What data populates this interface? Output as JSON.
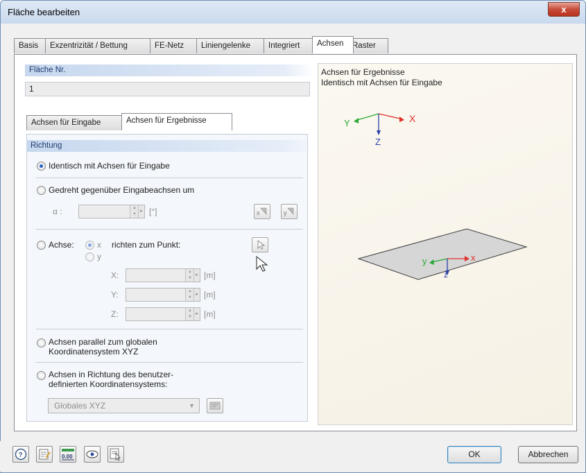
{
  "window": {
    "title": "Fläche bearbeiten",
    "close_label": "x"
  },
  "tabs": [
    "Basis",
    "Exzentrizität / Bettung",
    "FE-Netz",
    "Liniengelenke",
    "Integriert",
    "Achsen",
    "Raster"
  ],
  "active_tab": "Achsen",
  "flaeche": {
    "label": "Fläche Nr.",
    "value": "1"
  },
  "subtabs": [
    "Achsen für Eingabe",
    "Achsen für Ergebnisse"
  ],
  "active_subtab": "Achsen für Ergebnisse",
  "richtung": {
    "header": "Richtung",
    "opt_identisch": "Identisch mit Achsen für Eingabe",
    "opt_gedreht": "Gedreht gegenüber Eingabeachsen um",
    "alpha_label": "α :",
    "alpha_unit": "[°]",
    "opt_achse": "Achse:",
    "achse_x": "x",
    "achse_y": "y",
    "richten_label": "richten zum Punkt:",
    "x_label": "X:",
    "y_label": "Y:",
    "z_label": "Z:",
    "unit_m": "[m]",
    "opt_parallel_1": "Achsen parallel zum globalen",
    "opt_parallel_2": "Koordinatensystem XYZ",
    "opt_benutzer_1": "Achsen in Richtung des benutzer-",
    "opt_benutzer_2": "definierten Koordinatensystems:",
    "combo_value": "Globales XYZ"
  },
  "preview": {
    "line1": "Achsen für Ergebnisse",
    "line2": "Identisch mit Achsen für Eingabe",
    "axis_X": "X",
    "axis_Y": "Y",
    "axis_Z": "Z",
    "axis_x": "x",
    "axis_y": "y",
    "axis_z": "z"
  },
  "buttons": {
    "ok": "OK",
    "cancel": "Abbrechen"
  },
  "bottom_icon_value": "0.00",
  "colors": {
    "x_axis": "#e0302b",
    "y_axis": "#2aa836",
    "z_axis": "#2a3fa8",
    "panel_head": "#c6d7ee"
  }
}
